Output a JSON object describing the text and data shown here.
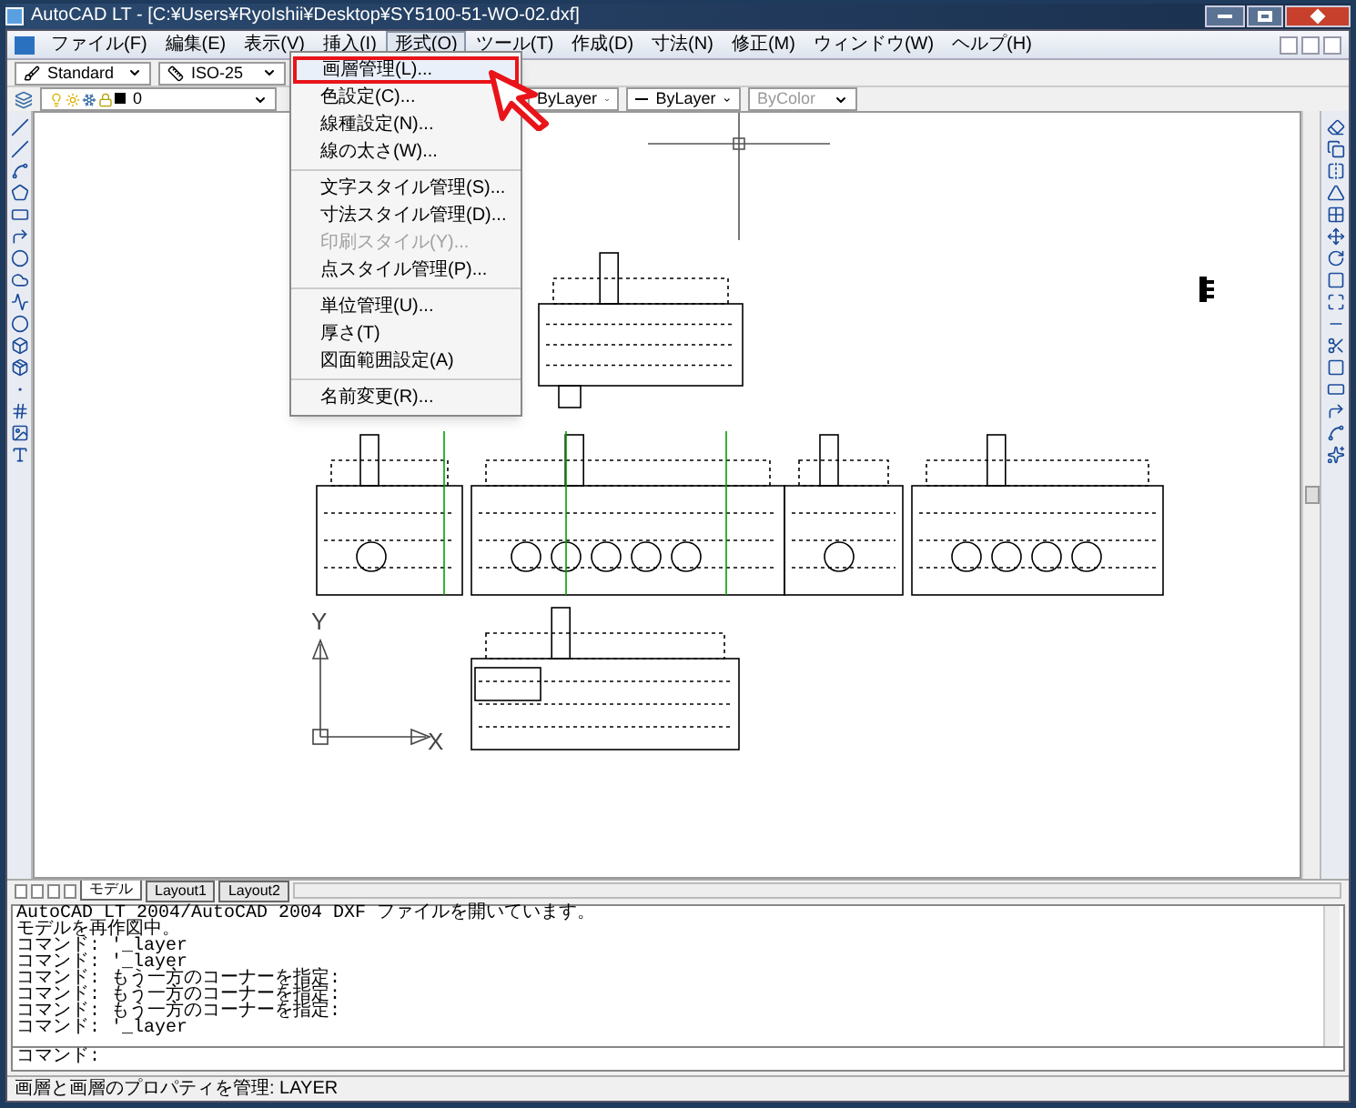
{
  "window": {
    "title": "AutoCAD LT - [C:¥Users¥RyoIshii¥Desktop¥SY5100-51-WO-02.dxf]"
  },
  "menu_bar": [
    {
      "label": "ファイル(F)",
      "selected": false
    },
    {
      "label": "編集(E)",
      "selected": false
    },
    {
      "label": "表示(V)",
      "selected": false
    },
    {
      "label": "挿入(I)",
      "selected": false
    },
    {
      "label": "形式(O)",
      "selected": true
    },
    {
      "label": "ツール(T)",
      "selected": false
    },
    {
      "label": "作成(D)",
      "selected": false
    },
    {
      "label": "寸法(N)",
      "selected": false
    },
    {
      "label": "修正(M)",
      "selected": false
    },
    {
      "label": "ウィンドウ(W)",
      "selected": false
    },
    {
      "label": "ヘルプ(H)",
      "selected": false
    }
  ],
  "toolbar": {
    "text_style": "Standard",
    "dim_style": "ISO-25",
    "layer": "0",
    "color_control": "ByLayer",
    "linetype": "ByLayer",
    "plot_style": "ByColor"
  },
  "dropdown_menu": [
    [
      {
        "label": "画層管理(L)...",
        "selected": true,
        "disabled": false
      },
      {
        "label": "色設定(C)...",
        "selected": false,
        "disabled": false
      },
      {
        "label": "線種設定(N)...",
        "selected": false,
        "disabled": false
      },
      {
        "label": "線の太さ(W)...",
        "selected": false,
        "disabled": false
      }
    ],
    [
      {
        "label": "文字スタイル管理(S)...",
        "selected": false,
        "disabled": false
      },
      {
        "label": "寸法スタイル管理(D)...",
        "selected": false,
        "disabled": false
      },
      {
        "label": "印刷スタイル(Y)...",
        "selected": false,
        "disabled": true
      },
      {
        "label": "点スタイル管理(P)...",
        "selected": false,
        "disabled": false
      }
    ],
    [
      {
        "label": "単位管理(U)...",
        "selected": false,
        "disabled": false
      },
      {
        "label": "厚さ(T)",
        "selected": false,
        "disabled": false
      },
      {
        "label": "図面範囲設定(A)",
        "selected": false,
        "disabled": false
      }
    ],
    [
      {
        "label": "名前変更(R)...",
        "selected": false,
        "disabled": false
      }
    ]
  ],
  "drawing": {
    "y_axis_label": "Y",
    "x_axis_label": "X"
  },
  "layout_tabs": [
    {
      "label": "モデル",
      "selected": true
    },
    {
      "label": "Layout1",
      "selected": false
    },
    {
      "label": "Layout2",
      "selected": false
    }
  ],
  "command_history": [
    "AutoCAD LT 2004/AutoCAD 2004 DXF ファイルを開いています。",
    "モデルを再作図中。",
    "コマンド: '_layer",
    "コマンド: '_layer",
    "コマンド: もう一方のコーナーを指定:",
    "コマンド: もう一方のコーナーを指定:",
    "コマンド: もう一方のコーナーを指定:",
    "コマンド: '_layer"
  ],
  "command_prompt": "コマンド:",
  "status_bar": "画層と画層のプロパティを管理:  LAYER"
}
